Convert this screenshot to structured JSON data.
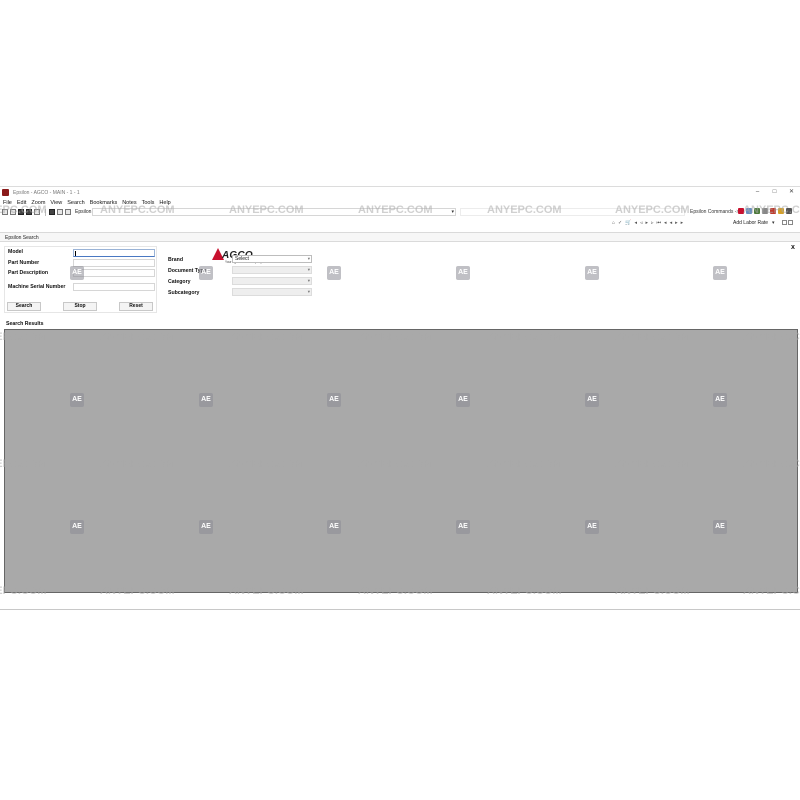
{
  "window": {
    "title": "Epsilon - AGCO - MAIN - 1 - 1",
    "controls": [
      "–",
      "□",
      "✕"
    ]
  },
  "menu": [
    "File",
    "Edit",
    "Zoom",
    "View",
    "Search",
    "Bookmarks",
    "Notes",
    "Tools",
    "Help"
  ],
  "toolbar": {
    "epsilon_label": "Epsilon",
    "combo_arrow": "▾",
    "commands_label": "Epsilon Commands ->",
    "labor_rate": "Add Labor Rate",
    "labor_dd": "▾"
  },
  "nav_icons": [
    "⌂",
    "✓",
    "🛒",
    "◂",
    "◃",
    "▸",
    "▹",
    "⏮",
    "◂",
    "◂",
    "▸",
    "▸"
  ],
  "panel": {
    "tab_label": "Epsilon Search",
    "close": "x"
  },
  "form": {
    "fields": [
      {
        "label": "Model",
        "value": ""
      },
      {
        "label": "Part Number",
        "value": ""
      },
      {
        "label": "Part Description",
        "value": ""
      },
      {
        "label": "Machine Serial Number",
        "value": ""
      }
    ],
    "buttons": {
      "search": "Search",
      "stop": "Stop",
      "reset": "Reset"
    }
  },
  "filters": {
    "logo_text": "AGCO",
    "logo_tagline": "Your Agriculture Company",
    "brand_label": "Brand",
    "brand_value": "Select",
    "document_type_label": "Document Type",
    "category_label": "Category",
    "subcategory_label": "Subcategory",
    "dd_arrow": "▾"
  },
  "results": {
    "label": "Search Results"
  },
  "watermark": {
    "text": "ANYEPC.COM",
    "logo": "AE"
  },
  "colors": {
    "results_bg": "#a9a9a9",
    "agco_red": "#c8102e"
  }
}
